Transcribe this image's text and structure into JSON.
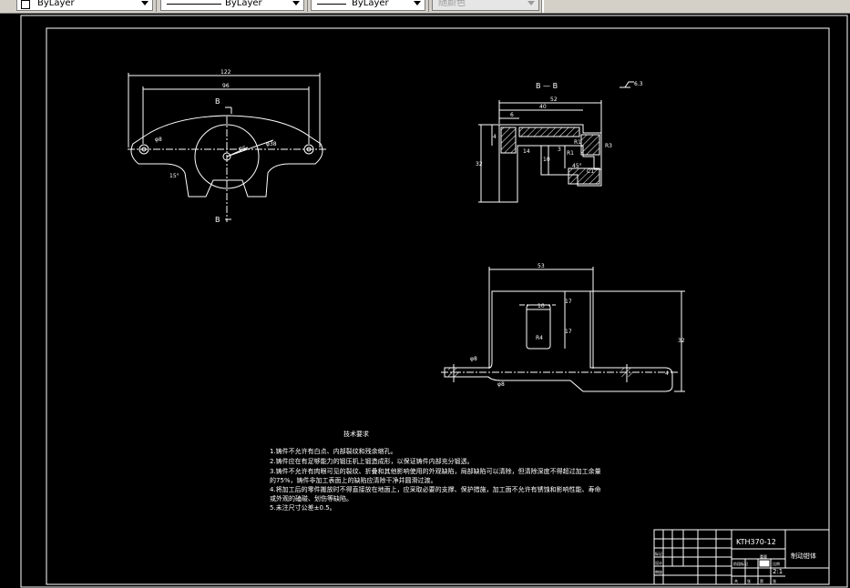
{
  "toolbar": {
    "color_combo": {
      "value": "ByLayer",
      "icon": "color-swatch-icon"
    },
    "linetype_combo": {
      "value": "ByLayer"
    },
    "lineweight_combo": {
      "value": "ByLayer"
    },
    "plotstyle_combo": {
      "value": "随颜色"
    }
  },
  "drawing": {
    "section_label": "B — B",
    "surface_mark": "6.3",
    "view1": {
      "dim_overall": "122",
      "dim_holes": "96",
      "cut_label_top": "B",
      "cut_label_bottom": "B",
      "dim_hole_left": "φ8",
      "dim_hole_center": "φ5",
      "dim_circle": "φ38",
      "dim_angle": "15°"
    },
    "view2": {
      "dim_top": "52",
      "dim_inner": "40",
      "dim_small_1": "6",
      "dim_small_2": "4",
      "dim_height": "32",
      "dim_side": "14",
      "dim_slot": "10",
      "dim_step": "3",
      "dim_r1": "R1",
      "dim_r2": "R1",
      "dim_r3": "R3",
      "dim_angle": "45°",
      "dim_chamfer": "C1"
    },
    "view3": {
      "dim_width": "53",
      "dim_slot_w": "10",
      "dim_slot_h": "17",
      "dim_slot_b": "17",
      "dim_radius": "R4",
      "dim_height": "32",
      "dim_foot": "4",
      "dim_left_hole": "φ8",
      "dim_bottom_hole": "φ8"
    }
  },
  "notes": {
    "title": "技术要求",
    "lines": [
      "1.铸件不允许有白点、内部裂纹和残余缩孔。",
      "2.铸件应在有足够能力的锻压机上锻造成形，以保证铸件内部充分锻透。",
      "3.铸件不允许有肉眼可见的裂纹、折叠和其他影响使用的外观缺陷，局部缺陷可以清除，但清除深度不得超过加工余量",
      "的75%，铸件非加工表面上的缺陷应清除干净并圆滑过渡。",
      "4.将加工后的零件搬放时不得直接放在地面上，应采取必要的支撑、保护措施，加工面不允许有锈蚀和影响性能、寿命",
      "或外观的磕碰、划伤等缺陷。",
      "5.未注尺寸公差±0.5。"
    ]
  },
  "title_block": {
    "drawing_no": "KTH370-12",
    "part_name": "制动钳体",
    "scale": "2:1",
    "row_labels": [
      "标记",
      "设计",
      "审核"
    ],
    "col_labels": [
      "阶段标记",
      "重量",
      "比例"
    ],
    "footer_labels": [
      "共",
      "张",
      "第",
      "张"
    ]
  }
}
